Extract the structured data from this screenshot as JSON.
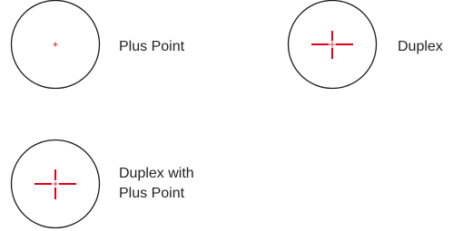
{
  "colors": {
    "reticle": "#e3001b",
    "outline": "#1a1a1a",
    "text": "#222222"
  },
  "reticles": [
    {
      "style": "plus-point",
      "label": "Plus Point"
    },
    {
      "style": "duplex",
      "label": "Duplex"
    },
    {
      "style": "duplex-plus-point",
      "line1": "Duplex with",
      "line2": "Plus Point"
    }
  ]
}
